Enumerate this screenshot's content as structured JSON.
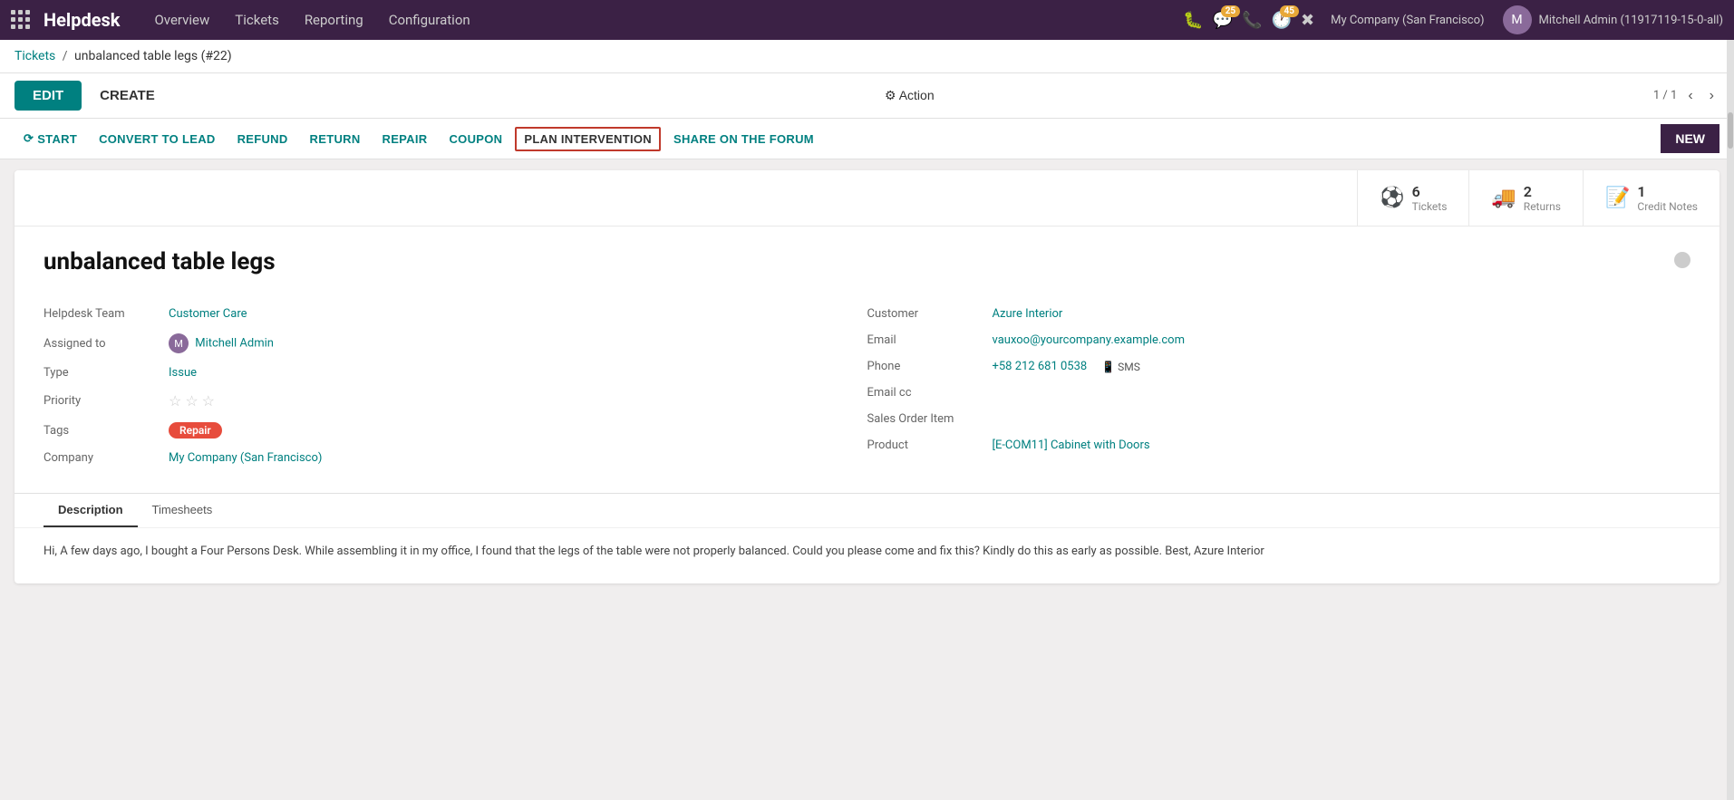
{
  "app": {
    "brand": "Helpdesk",
    "nav_items": [
      {
        "label": "Overview",
        "href": "#"
      },
      {
        "label": "Tickets",
        "href": "#"
      },
      {
        "label": "Reporting",
        "href": "#"
      },
      {
        "label": "Configuration",
        "href": "#"
      }
    ]
  },
  "topbar": {
    "icons": [
      {
        "name": "bug-icon",
        "symbol": "🐛"
      },
      {
        "name": "chat-icon",
        "symbol": "💬",
        "badge": "25"
      },
      {
        "name": "phone-icon",
        "symbol": "📞"
      },
      {
        "name": "clock-icon",
        "symbol": "🕐",
        "badge": "45"
      },
      {
        "name": "settings-icon",
        "symbol": "✖"
      }
    ],
    "company": "My Company (San Francisco)",
    "user": "Mitchell Admin (11917119-15-0-all)",
    "user_initials": "M"
  },
  "breadcrumb": {
    "parent": "Tickets",
    "current": "unbalanced table legs (#22)"
  },
  "toolbar": {
    "edit_label": "EDIT",
    "create_label": "CREATE",
    "action_label": "⚙ Action",
    "pagination": "1 / 1",
    "buttons": [
      {
        "label": "START",
        "icon": "⟳",
        "name": "start-btn"
      },
      {
        "label": "CONVERT TO LEAD",
        "name": "convert-lead-btn"
      },
      {
        "label": "REFUND",
        "name": "refund-btn"
      },
      {
        "label": "RETURN",
        "name": "return-btn"
      },
      {
        "label": "REPAIR",
        "name": "repair-btn"
      },
      {
        "label": "COUPON",
        "name": "coupon-btn"
      },
      {
        "label": "PLAN INTERVENTION",
        "name": "plan-intervention-btn",
        "active": true
      },
      {
        "label": "SHARE ON THE FORUM",
        "name": "share-forum-btn"
      }
    ],
    "new_label": "NEW"
  },
  "stats": [
    {
      "icon": "⚽",
      "number": "6",
      "label": "Tickets",
      "name": "tickets-stat"
    },
    {
      "icon": "🚚",
      "number": "2",
      "label": "Returns",
      "name": "returns-stat"
    },
    {
      "icon": "📝",
      "number": "1",
      "label": "Credit Notes",
      "name": "credit-notes-stat"
    }
  ],
  "record": {
    "title": "unbalanced table legs",
    "left_fields": [
      {
        "label": "Helpdesk Team",
        "value": "Customer Care",
        "type": "link"
      },
      {
        "label": "Assigned to",
        "value": "Mitchell Admin",
        "type": "avatar-link"
      },
      {
        "label": "Type",
        "value": "Issue",
        "type": "link"
      },
      {
        "label": "Priority",
        "value": "☆ ☆ ☆",
        "type": "stars"
      },
      {
        "label": "Tags",
        "value": "Repair",
        "type": "tag"
      },
      {
        "label": "Company",
        "value": "My Company (San Francisco)",
        "type": "link"
      }
    ],
    "right_fields": [
      {
        "label": "Customer",
        "value": "Azure Interior",
        "type": "link"
      },
      {
        "label": "Email",
        "value": "vauxoo@yourcompany.example.com",
        "type": "link"
      },
      {
        "label": "Phone",
        "value": "+58 212 681 0538",
        "type": "phone",
        "sms": "SMS"
      },
      {
        "label": "Email cc",
        "value": "",
        "type": "empty"
      },
      {
        "label": "Sales Order Item",
        "value": "",
        "type": "empty"
      },
      {
        "label": "Product",
        "value": "[E-COM11] Cabinet with Doors",
        "type": "link"
      }
    ],
    "tabs": [
      {
        "label": "Description",
        "active": true
      },
      {
        "label": "Timesheets",
        "active": false
      }
    ],
    "description": "Hi, A few days ago, I bought a Four Persons Desk. While assembling it in my office, I found that the legs of the table were not properly balanced. Could you please come and fix this? Kindly do this as early as possible. Best, Azure Interior"
  }
}
